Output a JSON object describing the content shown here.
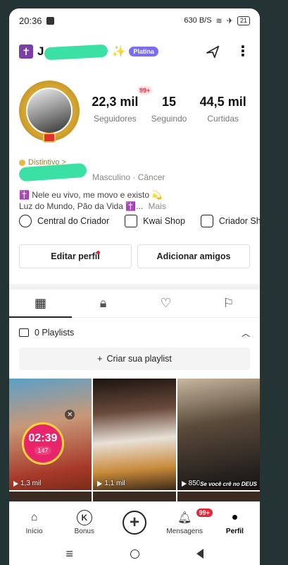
{
  "status_bar": {
    "time": "20:36",
    "net_speed": "630 B/S",
    "battery": "21"
  },
  "header": {
    "badge_glyph": "✝",
    "username": "J",
    "spark_glyph": "✨",
    "tier_badge": "Platina"
  },
  "stats": [
    {
      "value": "22,3 mil",
      "label": "Seguidores",
      "badge": "99+"
    },
    {
      "value": "15",
      "label": "Seguindo"
    },
    {
      "value": "44,5 mil",
      "label": "Curtidas"
    }
  ],
  "profile": {
    "distintivo": "Distintivo >",
    "info": "Masculino · Câncer",
    "bio_line1": "✝️ Nele eu vivo, me movo e existo 💫",
    "bio_line2": "Luz do Mundo, Pão da Vida ✝️...",
    "bio_more": "Mais"
  },
  "tools": [
    {
      "label": "Central do Criador",
      "icon": "lightning-circle-icon"
    },
    {
      "label": "Kwai Shop",
      "icon": "shopping-bag-icon"
    },
    {
      "label": "Criador Sho",
      "icon": "store-icon"
    }
  ],
  "buttons": {
    "edit": "Editar perfil",
    "add_friends": "Adicionar amigos"
  },
  "playlists": {
    "label": "0 Playlists",
    "create": "Criar sua playlist"
  },
  "videos": [
    {
      "views": "1,3 mil",
      "timer": "02:39",
      "coins": "147"
    },
    {
      "views": "1,1 mil"
    },
    {
      "views": "850",
      "caption": "Se você crê no DEUS"
    }
  ],
  "nav": {
    "home": "Início",
    "bonus": "Bonus",
    "messages": "Mensagens",
    "messages_badge": "99+",
    "profile": "Perfil"
  }
}
